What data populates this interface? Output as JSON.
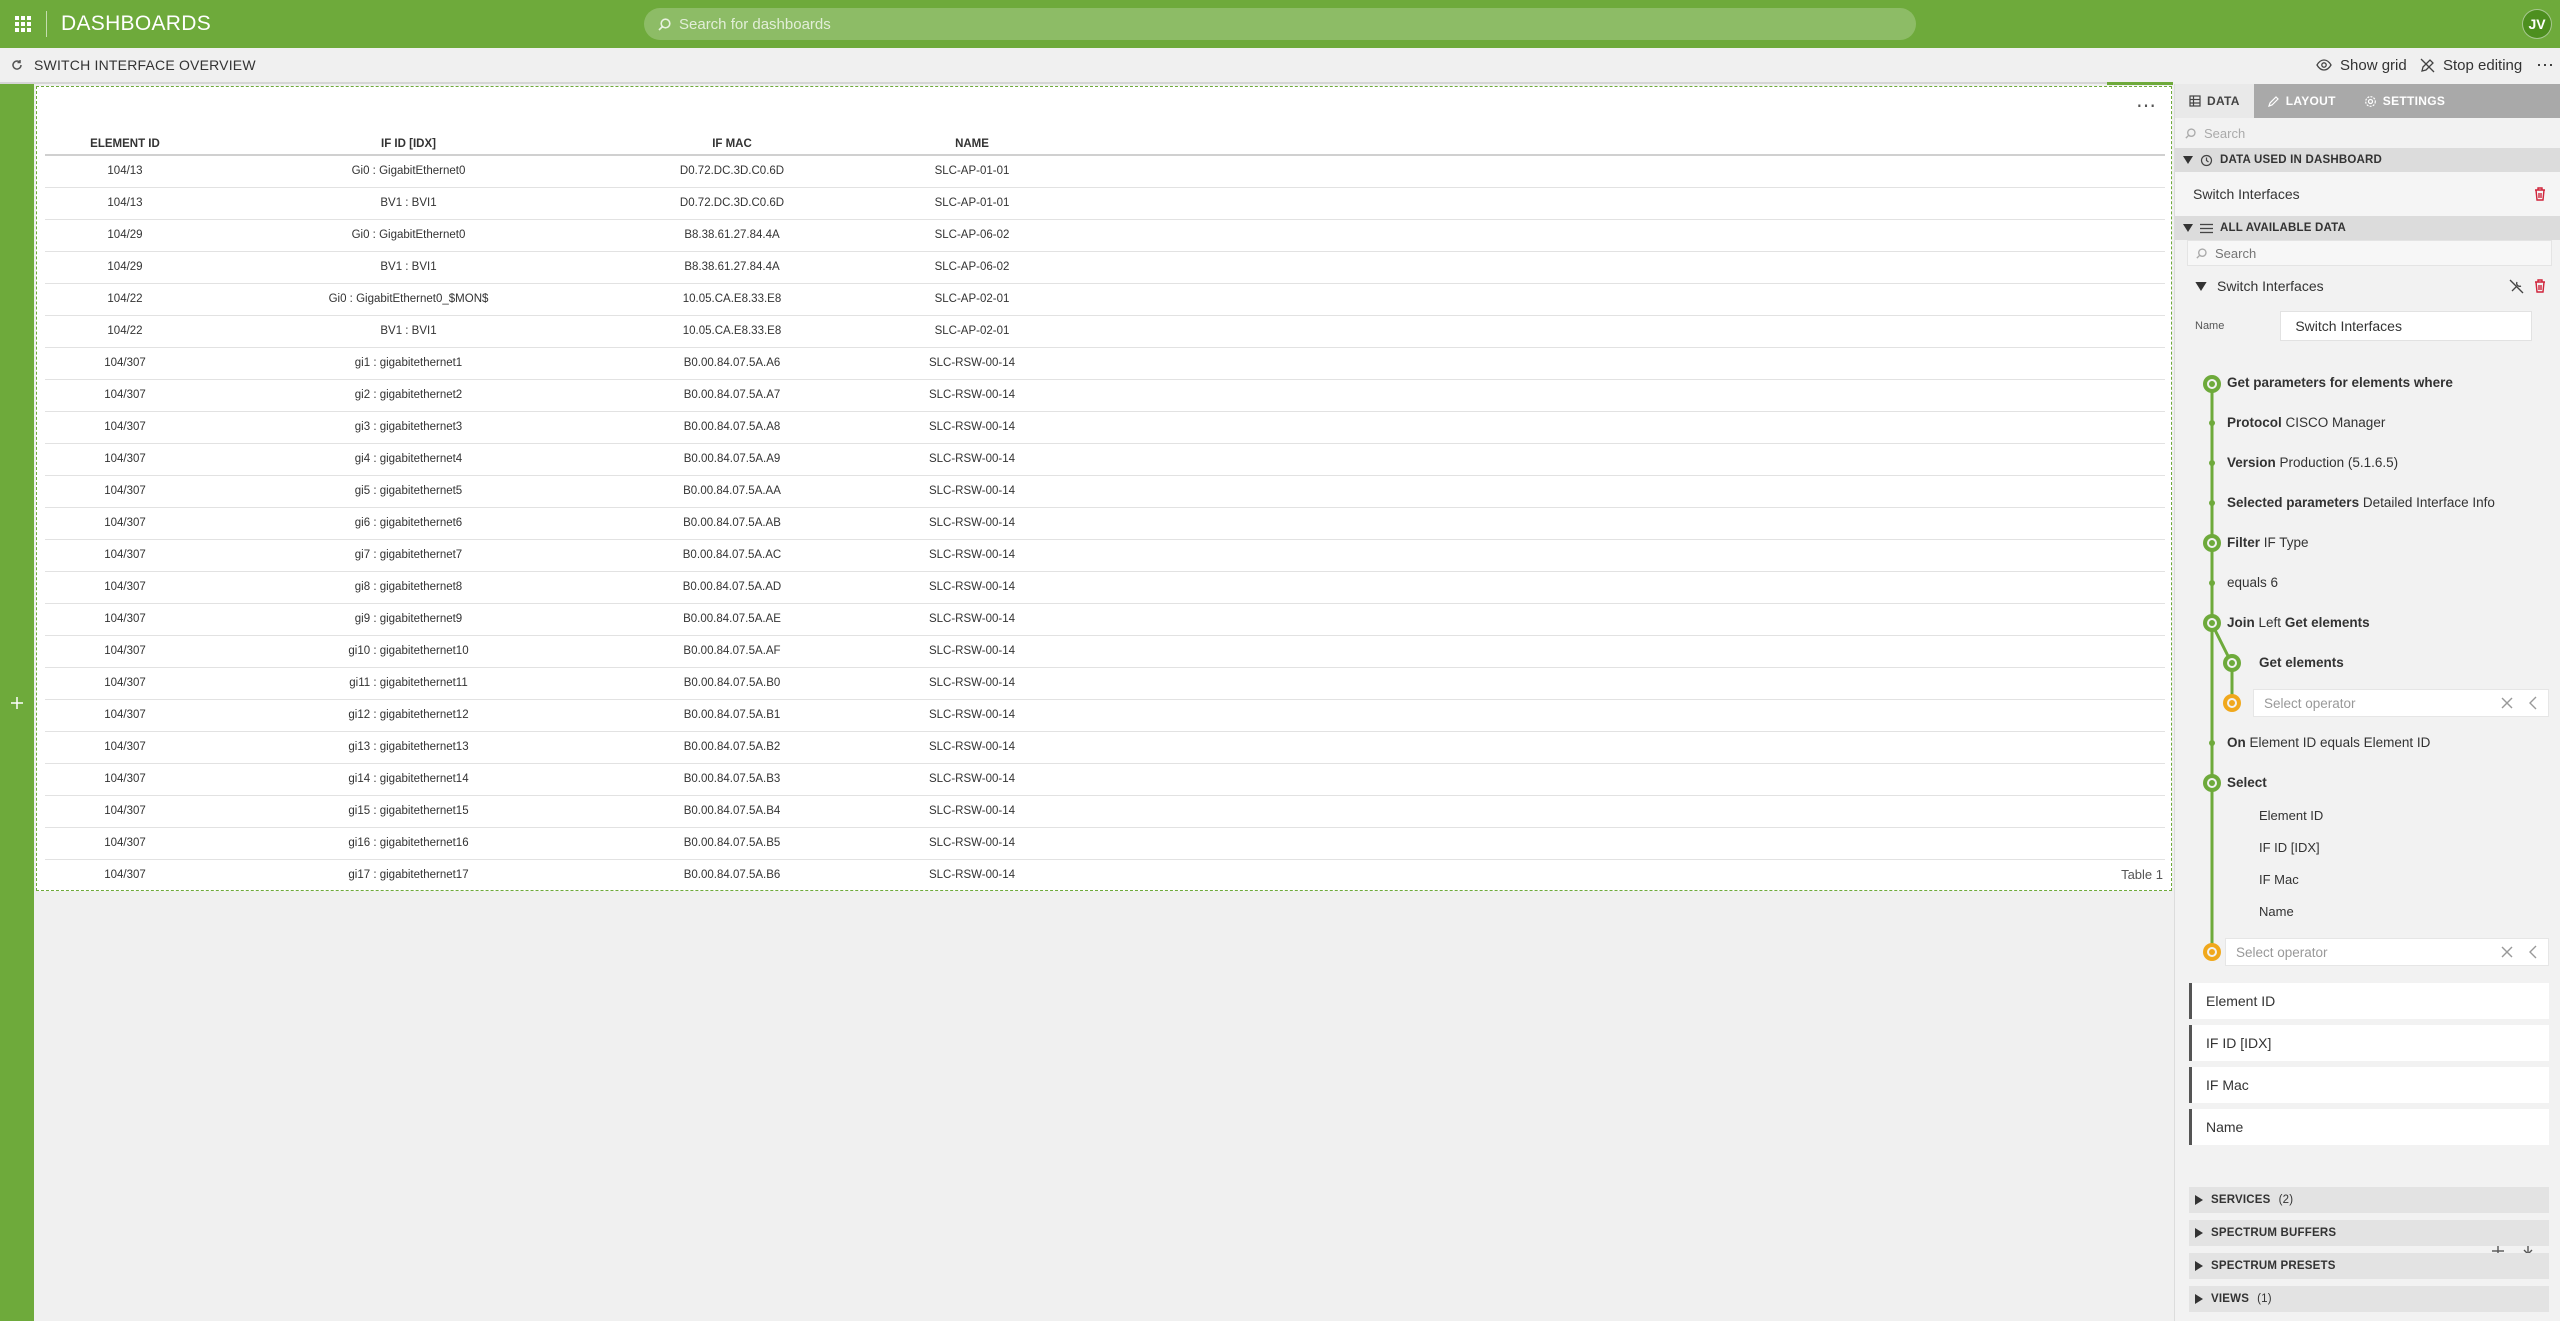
{
  "topbar": {
    "app_title": "DASHBOARDS",
    "search_placeholder": "Search for dashboards",
    "user_initials": "JV",
    "accent": "#6eaa3b"
  },
  "subbar": {
    "dashboard_title": "SWITCH INTERFACE OVERVIEW",
    "show_grid": "Show grid",
    "stop_editing": "Stop editing"
  },
  "table": {
    "label": "Table 1",
    "headers": [
      "ELEMENT ID",
      "IF ID [IDX]",
      "IF MAC",
      "NAME"
    ],
    "rows": [
      [
        "104/13",
        "Gi0 : GigabitEthernet0",
        "D0.72.DC.3D.C0.6D",
        "SLC-AP-01-01"
      ],
      [
        "104/13",
        "BV1 : BVI1",
        "D0.72.DC.3D.C0.6D",
        "SLC-AP-01-01"
      ],
      [
        "104/29",
        "Gi0 : GigabitEthernet0",
        "B8.38.61.27.84.4A",
        "SLC-AP-06-02"
      ],
      [
        "104/29",
        "BV1 : BVI1",
        "B8.38.61.27.84.4A",
        "SLC-AP-06-02"
      ],
      [
        "104/22",
        "Gi0 : GigabitEthernet0_$MON$",
        "10.05.CA.E8.33.E8",
        "SLC-AP-02-01"
      ],
      [
        "104/22",
        "BV1 : BVI1",
        "10.05.CA.E8.33.E8",
        "SLC-AP-02-01"
      ],
      [
        "104/307",
        "gi1 : gigabitethernet1",
        "B0.00.84.07.5A.A6",
        "SLC-RSW-00-14"
      ],
      [
        "104/307",
        "gi2 : gigabitethernet2",
        "B0.00.84.07.5A.A7",
        "SLC-RSW-00-14"
      ],
      [
        "104/307",
        "gi3 : gigabitethernet3",
        "B0.00.84.07.5A.A8",
        "SLC-RSW-00-14"
      ],
      [
        "104/307",
        "gi4 : gigabitethernet4",
        "B0.00.84.07.5A.A9",
        "SLC-RSW-00-14"
      ],
      [
        "104/307",
        "gi5 : gigabitethernet5",
        "B0.00.84.07.5A.AA",
        "SLC-RSW-00-14"
      ],
      [
        "104/307",
        "gi6 : gigabitethernet6",
        "B0.00.84.07.5A.AB",
        "SLC-RSW-00-14"
      ],
      [
        "104/307",
        "gi7 : gigabitethernet7",
        "B0.00.84.07.5A.AC",
        "SLC-RSW-00-14"
      ],
      [
        "104/307",
        "gi8 : gigabitethernet8",
        "B0.00.84.07.5A.AD",
        "SLC-RSW-00-14"
      ],
      [
        "104/307",
        "gi9 : gigabitethernet9",
        "B0.00.84.07.5A.AE",
        "SLC-RSW-00-14"
      ],
      [
        "104/307",
        "gi10 : gigabitethernet10",
        "B0.00.84.07.5A.AF",
        "SLC-RSW-00-14"
      ],
      [
        "104/307",
        "gi11 : gigabitethernet11",
        "B0.00.84.07.5A.B0",
        "SLC-RSW-00-14"
      ],
      [
        "104/307",
        "gi12 : gigabitethernet12",
        "B0.00.84.07.5A.B1",
        "SLC-RSW-00-14"
      ],
      [
        "104/307",
        "gi13 : gigabitethernet13",
        "B0.00.84.07.5A.B2",
        "SLC-RSW-00-14"
      ],
      [
        "104/307",
        "gi14 : gigabitethernet14",
        "B0.00.84.07.5A.B3",
        "SLC-RSW-00-14"
      ],
      [
        "104/307",
        "gi15 : gigabitethernet15",
        "B0.00.84.07.5A.B4",
        "SLC-RSW-00-14"
      ],
      [
        "104/307",
        "gi16 : gigabitethernet16",
        "B0.00.84.07.5A.B5",
        "SLC-RSW-00-14"
      ],
      [
        "104/307",
        "gi17 : gigabitethernet17",
        "B0.00.84.07.5A.B6",
        "SLC-RSW-00-14"
      ]
    ]
  },
  "panel": {
    "tabs": [
      "DATA",
      "LAYOUT",
      "SETTINGS"
    ],
    "search_placeholder": "Search",
    "used_header": "DATA USED IN DASHBOARD",
    "used_item": "Switch Interfaces",
    "all_header": "ALL AVAILABLE DATA",
    "sub_search_placeholder": "Search",
    "query": {
      "title": "Switch Interfaces",
      "name_label": "Name",
      "name_value": "Switch Interfaces",
      "get_params": "Get parameters for elements where",
      "protocol_k": "Protocol",
      "protocol_v": "CISCO Manager",
      "version_k": "Version",
      "version_v": "Production (5.1.6.5)",
      "selected_k": "Selected parameters",
      "selected_v": "Detailed Interface Info",
      "filter_k": "Filter",
      "filter_v": "IF Type",
      "equals": "equals 6",
      "join_k": "Join",
      "join_m": "Left",
      "join_v": "Get elements",
      "get_elements": "Get elements",
      "select_operator": "Select operator",
      "on_k": "On",
      "on_v": "Element ID equals Element ID",
      "select_k": "Select",
      "select_items": [
        "Element ID",
        "IF ID [IDX]",
        "IF Mac",
        "Name"
      ],
      "output_columns": [
        "Element ID",
        "IF ID [IDX]",
        "IF Mac",
        "Name"
      ]
    },
    "sections": [
      {
        "label": "SERVICES",
        "count": "(2)"
      },
      {
        "label": "SPECTRUM BUFFERS",
        "count": ""
      },
      {
        "label": "SPECTRUM PRESETS",
        "count": ""
      },
      {
        "label": "VIEWS",
        "count": "(1)"
      }
    ]
  }
}
